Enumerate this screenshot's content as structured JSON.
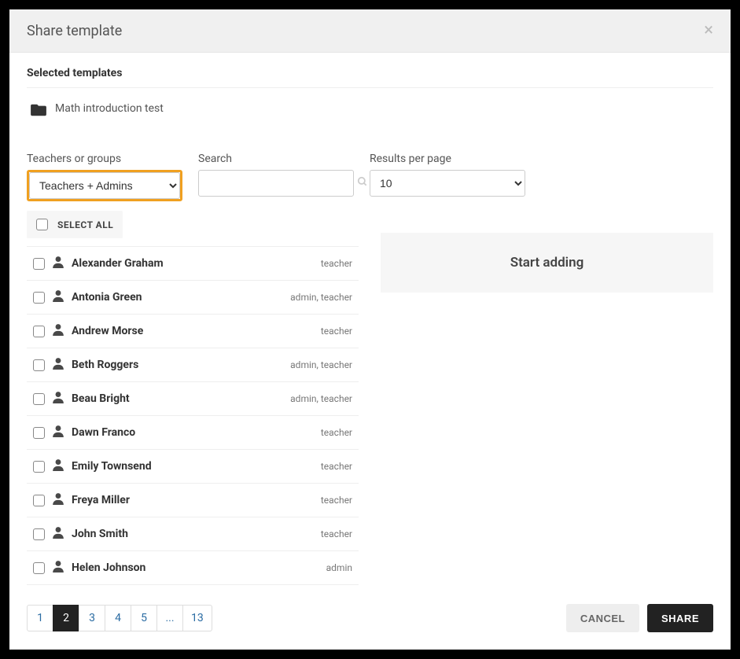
{
  "header": {
    "title": "Share template"
  },
  "selected": {
    "heading": "Selected templates",
    "template_name": "Math introduction test"
  },
  "filters": {
    "teachers_label": "Teachers or groups",
    "teachers_value": "Teachers + Admins",
    "search_label": "Search",
    "search_value": "",
    "rpp_label": "Results per page",
    "rpp_value": "10"
  },
  "select_all_label": "SELECT ALL",
  "users": [
    {
      "name": "Alexander Graham",
      "role": "teacher"
    },
    {
      "name": "Antonia Green",
      "role": "admin, teacher"
    },
    {
      "name": "Andrew Morse",
      "role": "teacher"
    },
    {
      "name": "Beth Roggers",
      "role": "admin, teacher"
    },
    {
      "name": "Beau Bright",
      "role": "admin, teacher"
    },
    {
      "name": "Dawn Franco",
      "role": "teacher"
    },
    {
      "name": "Emily Townsend",
      "role": "teacher"
    },
    {
      "name": "Freya Miller",
      "role": "teacher"
    },
    {
      "name": "John Smith",
      "role": "teacher"
    },
    {
      "name": "Helen Johnson",
      "role": "admin"
    }
  ],
  "start_adding_label": "Start adding",
  "pagination": {
    "pages": [
      "1",
      "2",
      "3",
      "4",
      "5",
      "...",
      "13"
    ],
    "active": "2"
  },
  "footer": {
    "cancel": "CANCEL",
    "share": "SHARE"
  }
}
